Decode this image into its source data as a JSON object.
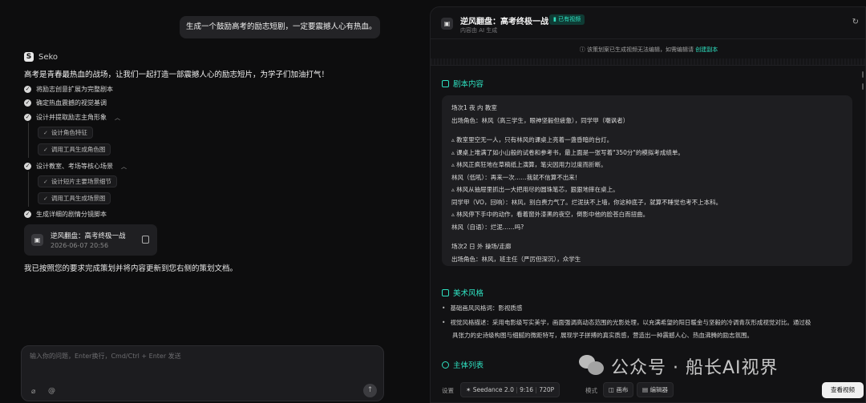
{
  "chat": {
    "user_message": "生成一个鼓励高考的励志短剧，一定要震撼人心有热血。",
    "bot_name": "Seko",
    "intro": "高考是青春最热血的战场，让我们一起打造一部震撼人心的励志短片，为学子们加油打气！",
    "steps": [
      "将励志创意扩展为完整剧本",
      "确定热血震撼的视觉基调",
      "设计并提取励志主角形象",
      "设计教室、考场等核心场景",
      "生成详细的剧情分镜脚本"
    ],
    "substeps_character": [
      "设计角色特征",
      "调用工具生成角色图"
    ],
    "substeps_scene": [
      "设计短片主要场景细节",
      "调用工具生成场景图"
    ],
    "doc_card": {
      "title": "逆风翻盘：高考终极一战",
      "date": "2026-06-07 20:56"
    },
    "done_text": "我已按照您的要求完成策划并将内容更新到您右侧的策划文档。",
    "composer_placeholder": "输入你的问题，Enter换行，Cmd/Ctrl + Enter 发送"
  },
  "panel": {
    "title": "逆风翻盘：高考终极一战",
    "badge": "已有视频",
    "subtitle": "内容由 AI 生成",
    "notice": "该策划案已生成视频无法编辑，如需编辑请",
    "notice_link": "创建副本",
    "section_script": "剧本内容",
    "script_lines": [
      "场次1  夜  内  教室",
      "出场角色：林风（高三学生，眼神坚毅但疲惫），同学甲（嘲讽者）",
      "",
      "▵ 教室里空无一人，只有林风的课桌上亮着一盏昏暗的台灯。",
      "▵ 课桌上堆满了如小山般的试卷和参考书，最上面是一张写着\"350分\"的模拟考成绩单。",
      "▵ 林风正疯狂地在草稿纸上演算，笔尖因用力过度而折断。",
      "林风（低吼）：再来一次……我就不信算不出来！",
      "▵ 林风从抽屉里抓出一大把用尽的圆珠笔芯，狠狠地摔在桌上。",
      "同学甲（VO，回响）：林风，别白费力气了。烂泥扶不上墙，你这种底子，就算不睡觉也考不上本科。",
      "▵ 林风停下手中的动作，看着窗外漆黑的夜空，倒影中他的脸苍白而扭曲。",
      "林风（自语）：烂泥……吗?",
      "",
      "场次2  日  外  操场/走廊",
      "出场角色：林风，班主任（严厉但深沉），众学生"
    ],
    "section_style": "美术风格",
    "style_bullets": [
      "基础画风风格词：影视质感",
      "视觉风格描述：采用电影级写实美学，画面强调高动态范围的光影处理，以充满希望的阳日暖金与坚毅的冷调青灰形成视觉对比。通过极"
    ],
    "style_bullet_cont": "具张力的史诗级构图与细腻的微距特写，展现学子拼搏的真实质感，营造出一种震撼人心、热血沸腾的励志氛围。",
    "section_subject": "主体列表",
    "footer": {
      "settings_label": "设置",
      "model": "Seedance 2.0",
      "ratio": "9:16",
      "resolution": "720P",
      "mode_label": "模式",
      "mode_canvas": "画布",
      "mode_editor": "编辑器",
      "view_button": "查看视频"
    }
  },
  "watermark": {
    "text": "公众号 · 船长AI视界"
  },
  "colors": {
    "accent": "#2ee0c0",
    "background": "#0d0d0e",
    "panel": "#121214"
  }
}
